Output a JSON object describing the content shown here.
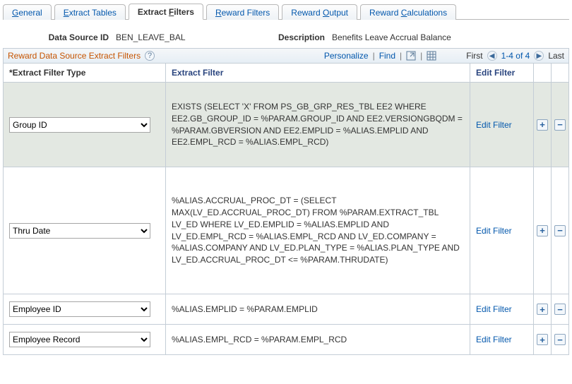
{
  "tabs": [
    {
      "pre": "",
      "ul": "G",
      "post": "eneral"
    },
    {
      "pre": "",
      "ul": "E",
      "post": "xtract Tables"
    },
    {
      "pre": "Extract ",
      "ul": "F",
      "post": "ilters"
    },
    {
      "pre": "",
      "ul": "R",
      "post": "eward Filters"
    },
    {
      "pre": "Reward ",
      "ul": "O",
      "post": "utput"
    },
    {
      "pre": "Reward ",
      "ul": "C",
      "post": "alculations"
    }
  ],
  "active_tab_index": 2,
  "header": {
    "data_source_id_label": "Data Source ID",
    "data_source_id_value": "BEN_LEAVE_BAL",
    "description_label": "Description",
    "description_value": "Benefits Leave Accrual Balance"
  },
  "section": {
    "title": "Reward Data Source Extract Filters",
    "personalize": "Personalize",
    "find": "Find",
    "first": "First",
    "range": "1-4 of 4",
    "last": "Last"
  },
  "columns": {
    "type_label": "*Extract Filter Type",
    "filter_label": "Extract Filter",
    "edit_label": "Edit Filter"
  },
  "type_options": [
    "Group ID",
    "Thru Date",
    "Employee ID",
    "Employee Record"
  ],
  "rows": [
    {
      "type": "Group ID",
      "sql": "EXISTS (SELECT 'X' FROM PS_GB_GRP_RES_TBL EE2 WHERE EE2.GB_GROUP_ID = %PARAM.GROUP_ID AND EE2.VERSIONGBQDM = %PARAM.GBVERSION AND EE2.EMPLID = %ALIAS.EMPLID AND EE2.EMPL_RCD = %ALIAS.EMPL_RCD)",
      "edit": "Edit Filter",
      "shade": true
    },
    {
      "type": "Thru Date",
      "sql": "%ALIAS.ACCRUAL_PROC_DT = (SELECT MAX(LV_ED.ACCRUAL_PROC_DT) FROM %PARAM.EXTRACT_TBL LV_ED WHERE LV_ED.EMPLID = %ALIAS.EMPLID AND LV_ED.EMPL_RCD = %ALIAS.EMPL_RCD AND LV_ED.COMPANY = %ALIAS.COMPANY AND LV_ED.PLAN_TYPE = %ALIAS.PLAN_TYPE AND LV_ED.ACCRUAL_PROC_DT <= %PARAM.THRUDATE)",
      "edit": "Edit Filter",
      "shade": false
    },
    {
      "type": "Employee ID",
      "sql": "%ALIAS.EMPLID = %PARAM.EMPLID",
      "edit": "Edit Filter",
      "shade": false
    },
    {
      "type": "Employee Record",
      "sql": "%ALIAS.EMPL_RCD = %PARAM.EMPL_RCD",
      "edit": "Edit Filter",
      "shade": false
    }
  ]
}
